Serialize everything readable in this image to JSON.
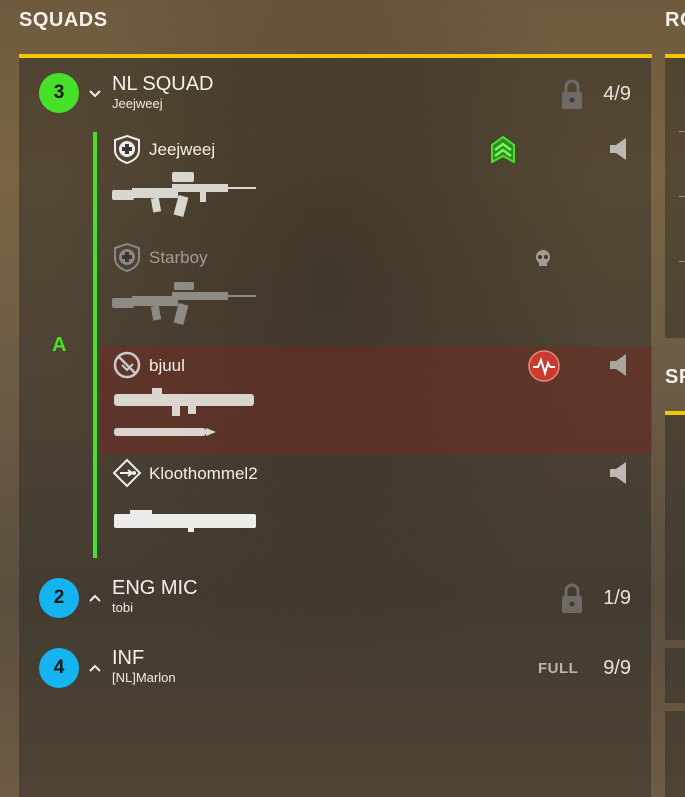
{
  "header": {
    "title": "SQUADS",
    "side_title": "RO",
    "side_title_2": "SP"
  },
  "colors": {
    "accent": "#f4c400",
    "fireteam": "#48e12a",
    "squad_blue": "#14b4f0",
    "medic_red": "#c93a30"
  },
  "squads": [
    {
      "number": "3",
      "name": "NL SQUAD",
      "leader": "Jeejweej",
      "count": "4/9",
      "locked": true,
      "expanded": true,
      "fireteam": "A",
      "members": [
        {
          "name": "Jeejweej",
          "role": "medic-icon",
          "status": "squad-leader-rank-icon",
          "weapon": "assault-rifle-icon",
          "voice": true
        },
        {
          "name": "Starboy",
          "role": "medic-icon",
          "status": "skull-icon",
          "weapon": "assault-rifle-icon",
          "voice": false
        },
        {
          "name": "bjuul",
          "role": "anti-tank-icon",
          "status": "revive-icon",
          "weapon": "recoilless-launcher-icon",
          "voice": true
        },
        {
          "name": "Kloothommel2",
          "role": "grenadier-icon",
          "status": "",
          "weapon": "rocket-launcher-icon",
          "voice": true
        }
      ]
    },
    {
      "number": "2",
      "name": "ENG MIC",
      "leader": "tobi",
      "count": "1/9",
      "locked": true,
      "expanded": false
    },
    {
      "number": "4",
      "name": "INF",
      "leader": "[NL]Marlon",
      "count": "9/9",
      "full_label": "FULL",
      "expanded": false
    }
  ]
}
